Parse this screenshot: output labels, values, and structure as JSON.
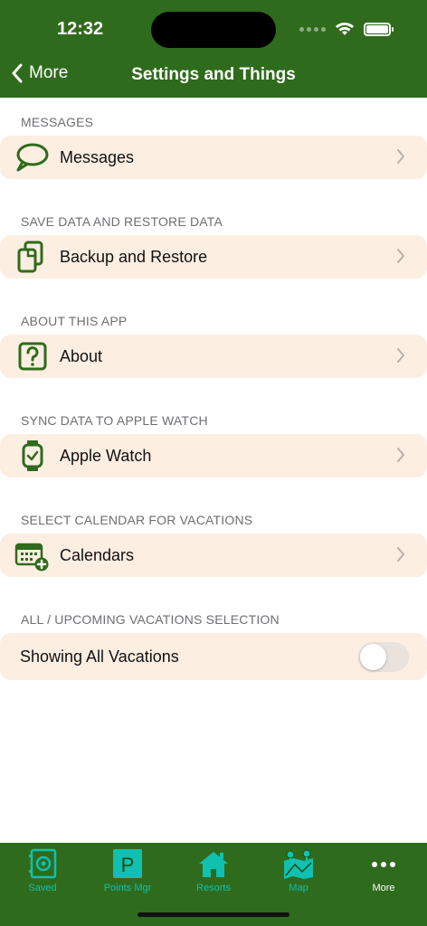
{
  "status": {
    "time": "12:32"
  },
  "nav": {
    "back_label": "More",
    "title": "Settings and Things"
  },
  "sections": [
    {
      "header": "MESSAGES",
      "label": "Messages",
      "icon": "speech-bubble-icon"
    },
    {
      "header": "SAVE DATA AND RESTORE DATA",
      "label": "Backup and Restore",
      "icon": "documents-icon"
    },
    {
      "header": "ABOUT THIS APP",
      "label": "About",
      "icon": "question-square-icon"
    },
    {
      "header": "SYNC DATA TO APPLE WATCH",
      "label": "Apple Watch",
      "icon": "apple-watch-icon"
    },
    {
      "header": "SELECT CALENDAR FOR VACATIONS",
      "label": "Calendars",
      "icon": "calendar-add-icon"
    }
  ],
  "vacations": {
    "header": "ALL / UPCOMING VACATIONS SELECTION",
    "label": "Showing All Vacations",
    "toggle_on": false
  },
  "tabs": [
    {
      "label": "Saved",
      "icon": "saved-safe-icon"
    },
    {
      "label": "Points Mgr",
      "icon": "points-p-icon"
    },
    {
      "label": "Resorts",
      "icon": "house-icon"
    },
    {
      "label": "Map",
      "icon": "map-icon"
    },
    {
      "label": "More",
      "icon": "more-dots-icon",
      "active": true
    }
  ],
  "colors": {
    "brand_green": "#2f6b1c",
    "row_background": "#fdeee2",
    "tab_accent": "#10c0b0",
    "icon_green": "#2f6b1c"
  }
}
